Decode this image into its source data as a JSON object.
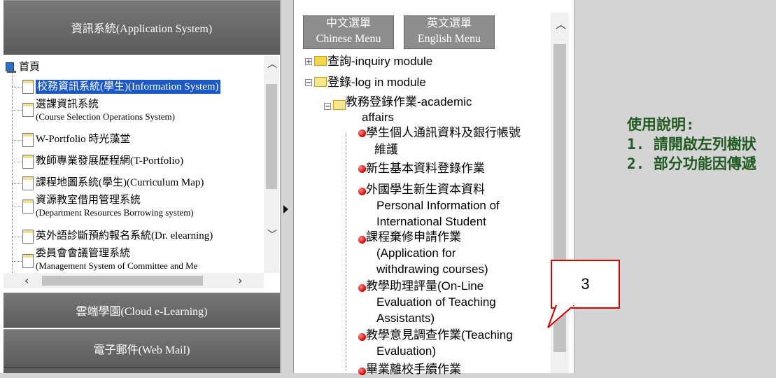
{
  "left_panel": {
    "header_label": "資訊系統(Application System)",
    "home_label": "首頁",
    "tree_items": [
      {
        "label": "校務資訊系統(學生)(Information System)"
      },
      {
        "label": "選課資訊系統",
        "sub": "(Course Selection Operations System)"
      },
      {
        "label": "W-Portfolio 時光藻堂"
      },
      {
        "label": "教師專業發展歷程網(T-Portfolio)"
      },
      {
        "label": "課程地圖系統(學生)(Curriculum Map)"
      },
      {
        "label": "資源教室借用管理系統",
        "sub": "(Department Resources Borrowing system)"
      },
      {
        "label": "英外語診斷預約報名系統(Dr. elearning)"
      },
      {
        "label": "委員會會議管理系統",
        "sub": "(Management System of Committee and Me"
      }
    ],
    "cloud_label": "雲端學園(Cloud e-Learning)",
    "mail_label": "電子郵件(Web Mail)"
  },
  "middle_panel": {
    "chinese_menu": {
      "line1": "中文選單",
      "line2": "Chinese Menu"
    },
    "english_menu": {
      "line1": "英文選單",
      "line2": "English Menu"
    },
    "inquiry_label": "查詢-inquiry module",
    "login_label": "登錄-log in module",
    "academic_label_1": "教務登錄作業-academic",
    "academic_label_2": "affairs",
    "leaves": [
      {
        "lines": [
          "學生個人通訊資料及銀行帳號",
          "維護"
        ]
      },
      {
        "lines": [
          "新生基本資料登錄作業"
        ]
      },
      {
        "lines": [
          "外國學生新生資本資料",
          "Personal Information of",
          "International Student"
        ]
      },
      {
        "lines": [
          "課程棄修申請作業",
          "(Application for",
          "withdrawing courses)"
        ]
      },
      {
        "lines": [
          "教學助理評量(On-Line",
          "Evaluation of Teaching",
          "Assistants)"
        ]
      },
      {
        "lines": [
          "教學意見調查作業(Teaching",
          "Evaluation)"
        ]
      },
      {
        "lines": [
          "畢業離校手續作業"
        ]
      }
    ]
  },
  "right_panel": {
    "usage_title": "使用說明:",
    "usage_1": "1. 請開啟左列樹狀",
    "usage_2": "2. 部分功能因傳遞"
  },
  "callout": {
    "text": "3",
    "color": "#d40000"
  }
}
